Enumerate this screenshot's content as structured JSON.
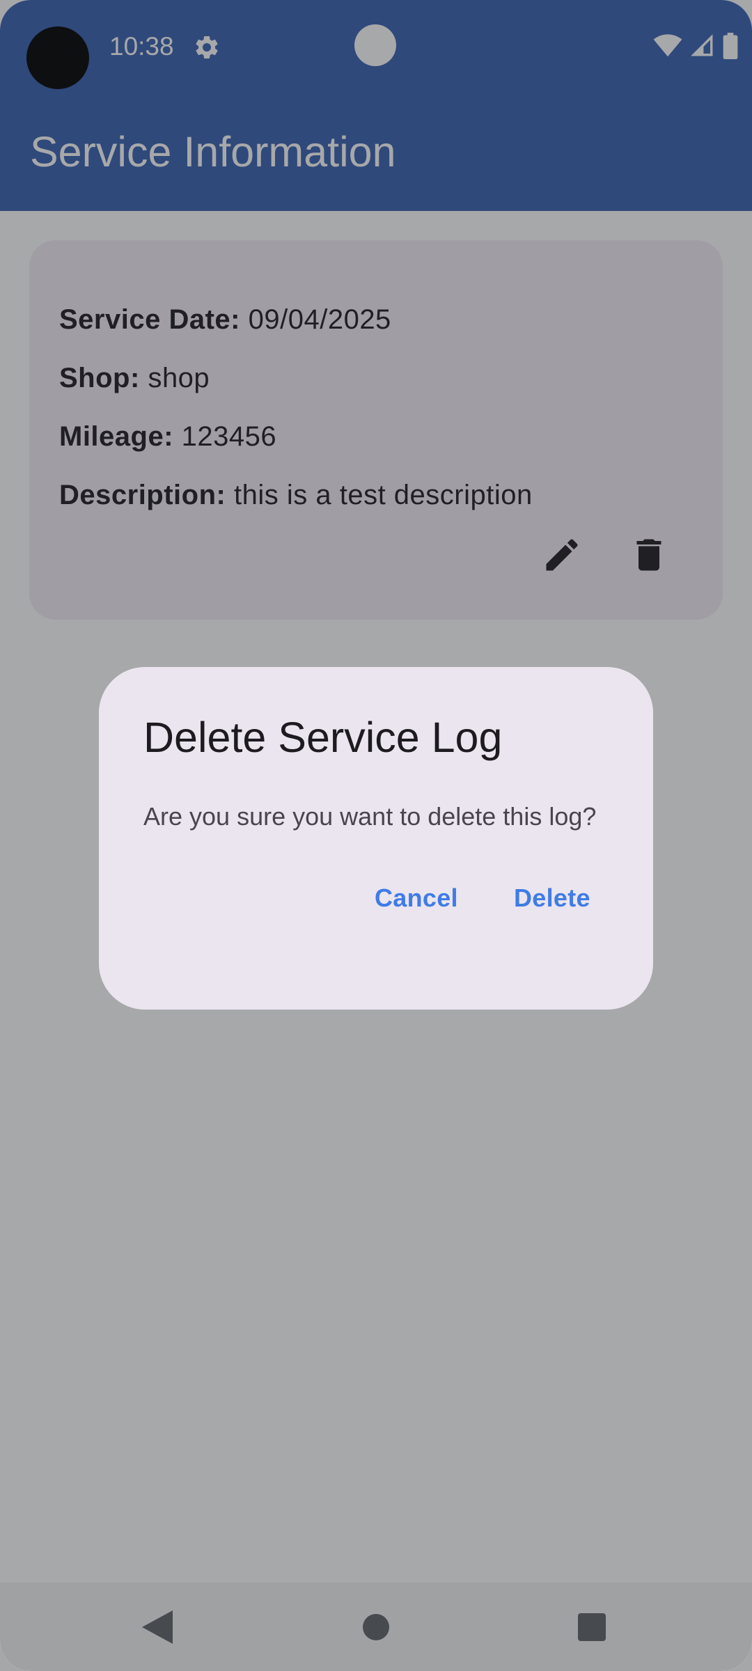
{
  "status_bar": {
    "time": "10:38",
    "icons": [
      "settings-icon",
      "wifi-icon",
      "signal-icon",
      "battery-icon"
    ]
  },
  "app_bar": {
    "title": "Service Information",
    "color": "#3761b0"
  },
  "service_card": {
    "date_label": "Service Date:",
    "date_value": "09/04/2025",
    "shop_label": "Shop:",
    "shop_value": "shop",
    "mileage_label": "Mileage:",
    "mileage_value": "123456",
    "description_label": "Description:",
    "description_value": "this is a test description",
    "actions": [
      "edit-icon",
      "delete-icon"
    ]
  },
  "dialog": {
    "title": "Delete Service Log",
    "message": "Are you sure you want to delete this log?",
    "cancel_label": "Cancel",
    "confirm_label": "Delete",
    "accent": "#3f7ce6"
  },
  "nav_bar": {
    "buttons": [
      "back-icon",
      "home-icon",
      "recents-icon"
    ]
  }
}
